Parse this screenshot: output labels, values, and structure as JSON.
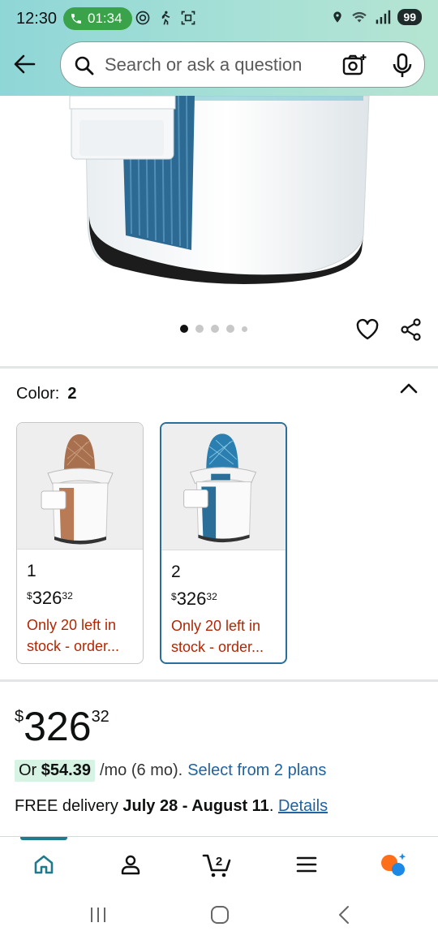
{
  "status_bar": {
    "time": "12:30",
    "call_timer": "01:34",
    "battery": "99",
    "left_icons": [
      "data-saver-icon",
      "walk-icon",
      "screenshot-icon"
    ],
    "right_icons": [
      "location-icon",
      "wifi-icon",
      "signal-icon"
    ]
  },
  "header": {
    "back_icon": "arrow-left-icon",
    "search_placeholder": "Search or ask a question",
    "camera_icon": "camera-search-icon",
    "mic_icon": "mic-icon"
  },
  "gallery": {
    "image": "portable toilet product image (white & blue)",
    "dot_count": 5,
    "active_index": 0,
    "actions": [
      "heart-icon",
      "share-icon"
    ]
  },
  "color_selector": {
    "label": "Color:",
    "selected": "2",
    "collapse_icon": "chevron-up-icon",
    "options": [
      {
        "name": "1",
        "currency": "$",
        "price_whole": "326",
        "price_cents": "32",
        "stock": "Only 20 left in stock - order...",
        "accent": "#b87b55"
      },
      {
        "name": "2",
        "currency": "$",
        "price_whole": "326",
        "price_cents": "32",
        "stock": "Only 20 left in stock - order...",
        "accent": "#2b6f98"
      }
    ]
  },
  "price": {
    "currency": "$",
    "whole": "326",
    "cents": "32"
  },
  "installments": {
    "prefix": "Or",
    "amount": "$54.39",
    "per": "/mo (6 mo).",
    "link": "Select from 2 plans"
  },
  "delivery": {
    "prefix": "FREE delivery",
    "dates": "July 28 - August 11",
    "suffix": ".",
    "link": "Details"
  },
  "bottom_nav": {
    "items": [
      "home-icon",
      "account-icon",
      "cart-icon",
      "menu-icon",
      "rufus-icon"
    ],
    "cart_count": "2",
    "active": "home"
  },
  "colors": {
    "accent_teal": "#1f7a8c",
    "link_blue": "#2162a1",
    "stock_red": "#b12704",
    "selected_border": "#2a6f9b"
  }
}
